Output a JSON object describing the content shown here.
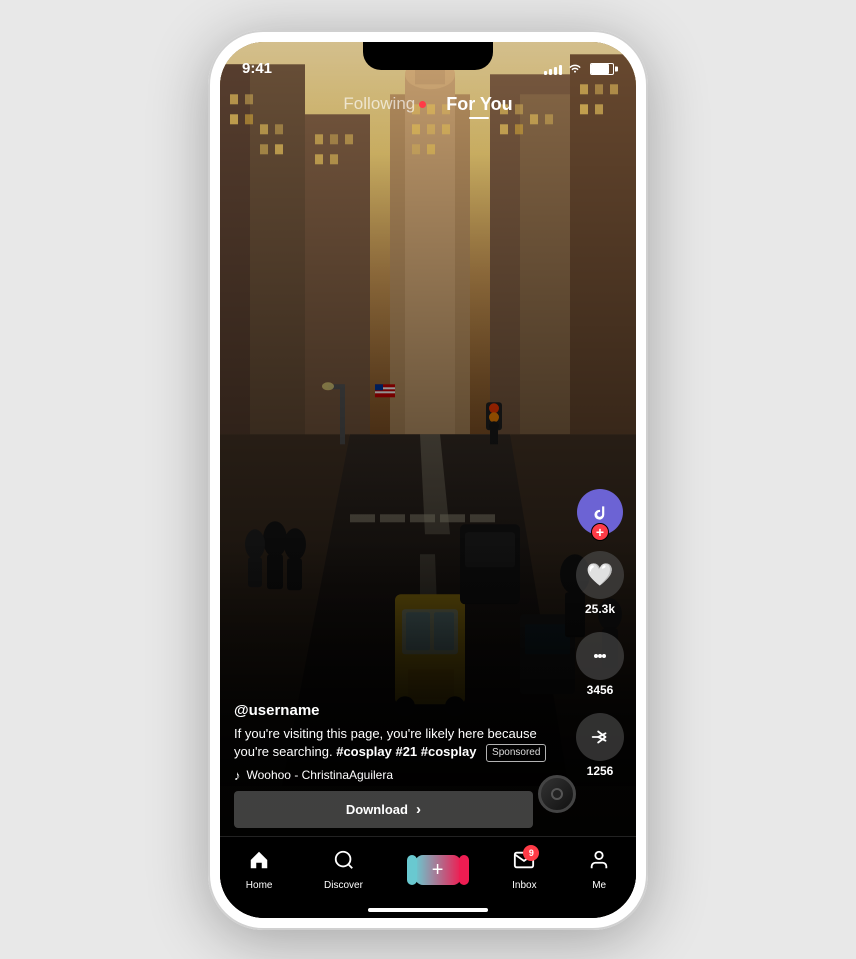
{
  "status_bar": {
    "time": "9:41",
    "battery_pct": 80
  },
  "feed_nav": {
    "following_label": "Following",
    "for_you_label": "For You",
    "active_tab": "for_you"
  },
  "video": {
    "username": "@username",
    "description_text": "If you're visiting this page, you're likely here because you're searching.",
    "hashtags": "#cosplay #21 #cosplay",
    "sponsored_label": "Sponsored",
    "music_note": "♪",
    "music_text": "Woohoo - ChristinaAguilera"
  },
  "actions": {
    "like_count": "25.3k",
    "comment_count": "3456",
    "share_count": "1256"
  },
  "download_btn": {
    "label": "Download",
    "chevron": "›"
  },
  "bottom_nav": {
    "home_label": "Home",
    "discover_label": "Discover",
    "inbox_label": "Inbox",
    "inbox_badge": "9",
    "me_label": "Me"
  }
}
